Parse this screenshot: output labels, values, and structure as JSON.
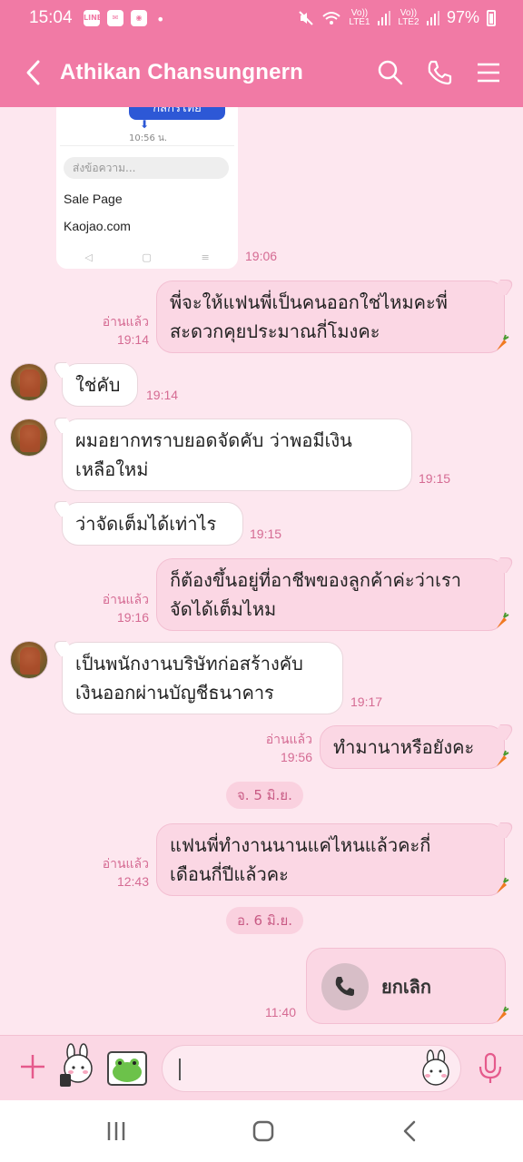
{
  "status_bar": {
    "time": "15:04",
    "app_icons": [
      "LINE",
      "mail",
      "app"
    ],
    "network_1": "Vo)) LTE1",
    "network_2": "Vo)) LTE2",
    "battery": "97%"
  },
  "header": {
    "title": "Athikan Chansungnern",
    "icons": [
      "back-icon",
      "search-icon",
      "phone-icon",
      "menu-icon"
    ]
  },
  "shared_image": {
    "bank_button": "กสิกรไทย",
    "time_text": "10:56 น.",
    "input_placeholder": "ส่งข้อความ...",
    "item_1": "Sale Page",
    "item_2": "Kaojao.com",
    "nav": [
      "◁",
      "▢",
      "≡"
    ],
    "sent_time": "19:06"
  },
  "messages": [
    {
      "dir": "out",
      "text_lines": [
        "พี่จะให้แฟนพี่เป็นคนออกใช่ไหมคะพี่",
        "สะดวกคุยประมาณกี่โมงคะ"
      ],
      "read": "อ่านแล้ว",
      "time": "19:14"
    },
    {
      "dir": "in",
      "text_lines": [
        "ใช่คับ"
      ],
      "time": "19:14"
    },
    {
      "dir": "in",
      "text_lines": [
        "ผมอยากทราบยอดจัดคับ ว่าพอมีเงิน",
        "เหลือใหม่"
      ],
      "time": "19:15"
    },
    {
      "dir": "in",
      "text_lines": [
        "ว่าจัดเต็มได้เท่าไร"
      ],
      "time": "19:15"
    },
    {
      "dir": "out",
      "text_lines": [
        "ก็ต้องขึ้นอยู่ที่อาชีพของลูกค้าค่ะว่าเรา",
        "จัดได้เต็มไหม"
      ],
      "read": "อ่านแล้ว",
      "time": "19:16"
    },
    {
      "dir": "in",
      "text_lines": [
        "เป็นพนักงานบริษัทก่อสร้างคับ",
        "เงินออกผ่านบัญชีธนาคาร"
      ],
      "time": "19:17"
    },
    {
      "dir": "out",
      "text_lines": [
        "ทำมานาหรือยังคะ"
      ],
      "read": "อ่านแล้ว",
      "time": "19:56"
    },
    {
      "dir": "out",
      "text_lines": [
        "แฟนพี่ทำงานนานแค่ไหนแล้วคะกี่",
        "เดือนกี่ปีแล้วคะ"
      ],
      "read": "อ่านแล้ว",
      "time": "12:43"
    }
  ],
  "dates": [
    "จ. 5 มิ.ย.",
    "อ. 6 มิ.ย."
  ],
  "call": {
    "label": "ยกเลิก",
    "time": "11:40"
  },
  "input": {
    "placeholder": ""
  },
  "colors": {
    "header": "#f17aa5",
    "chat_bg": "#fde7ef",
    "out_bubble": "#fbd7e4",
    "meta": "#d56b93"
  }
}
